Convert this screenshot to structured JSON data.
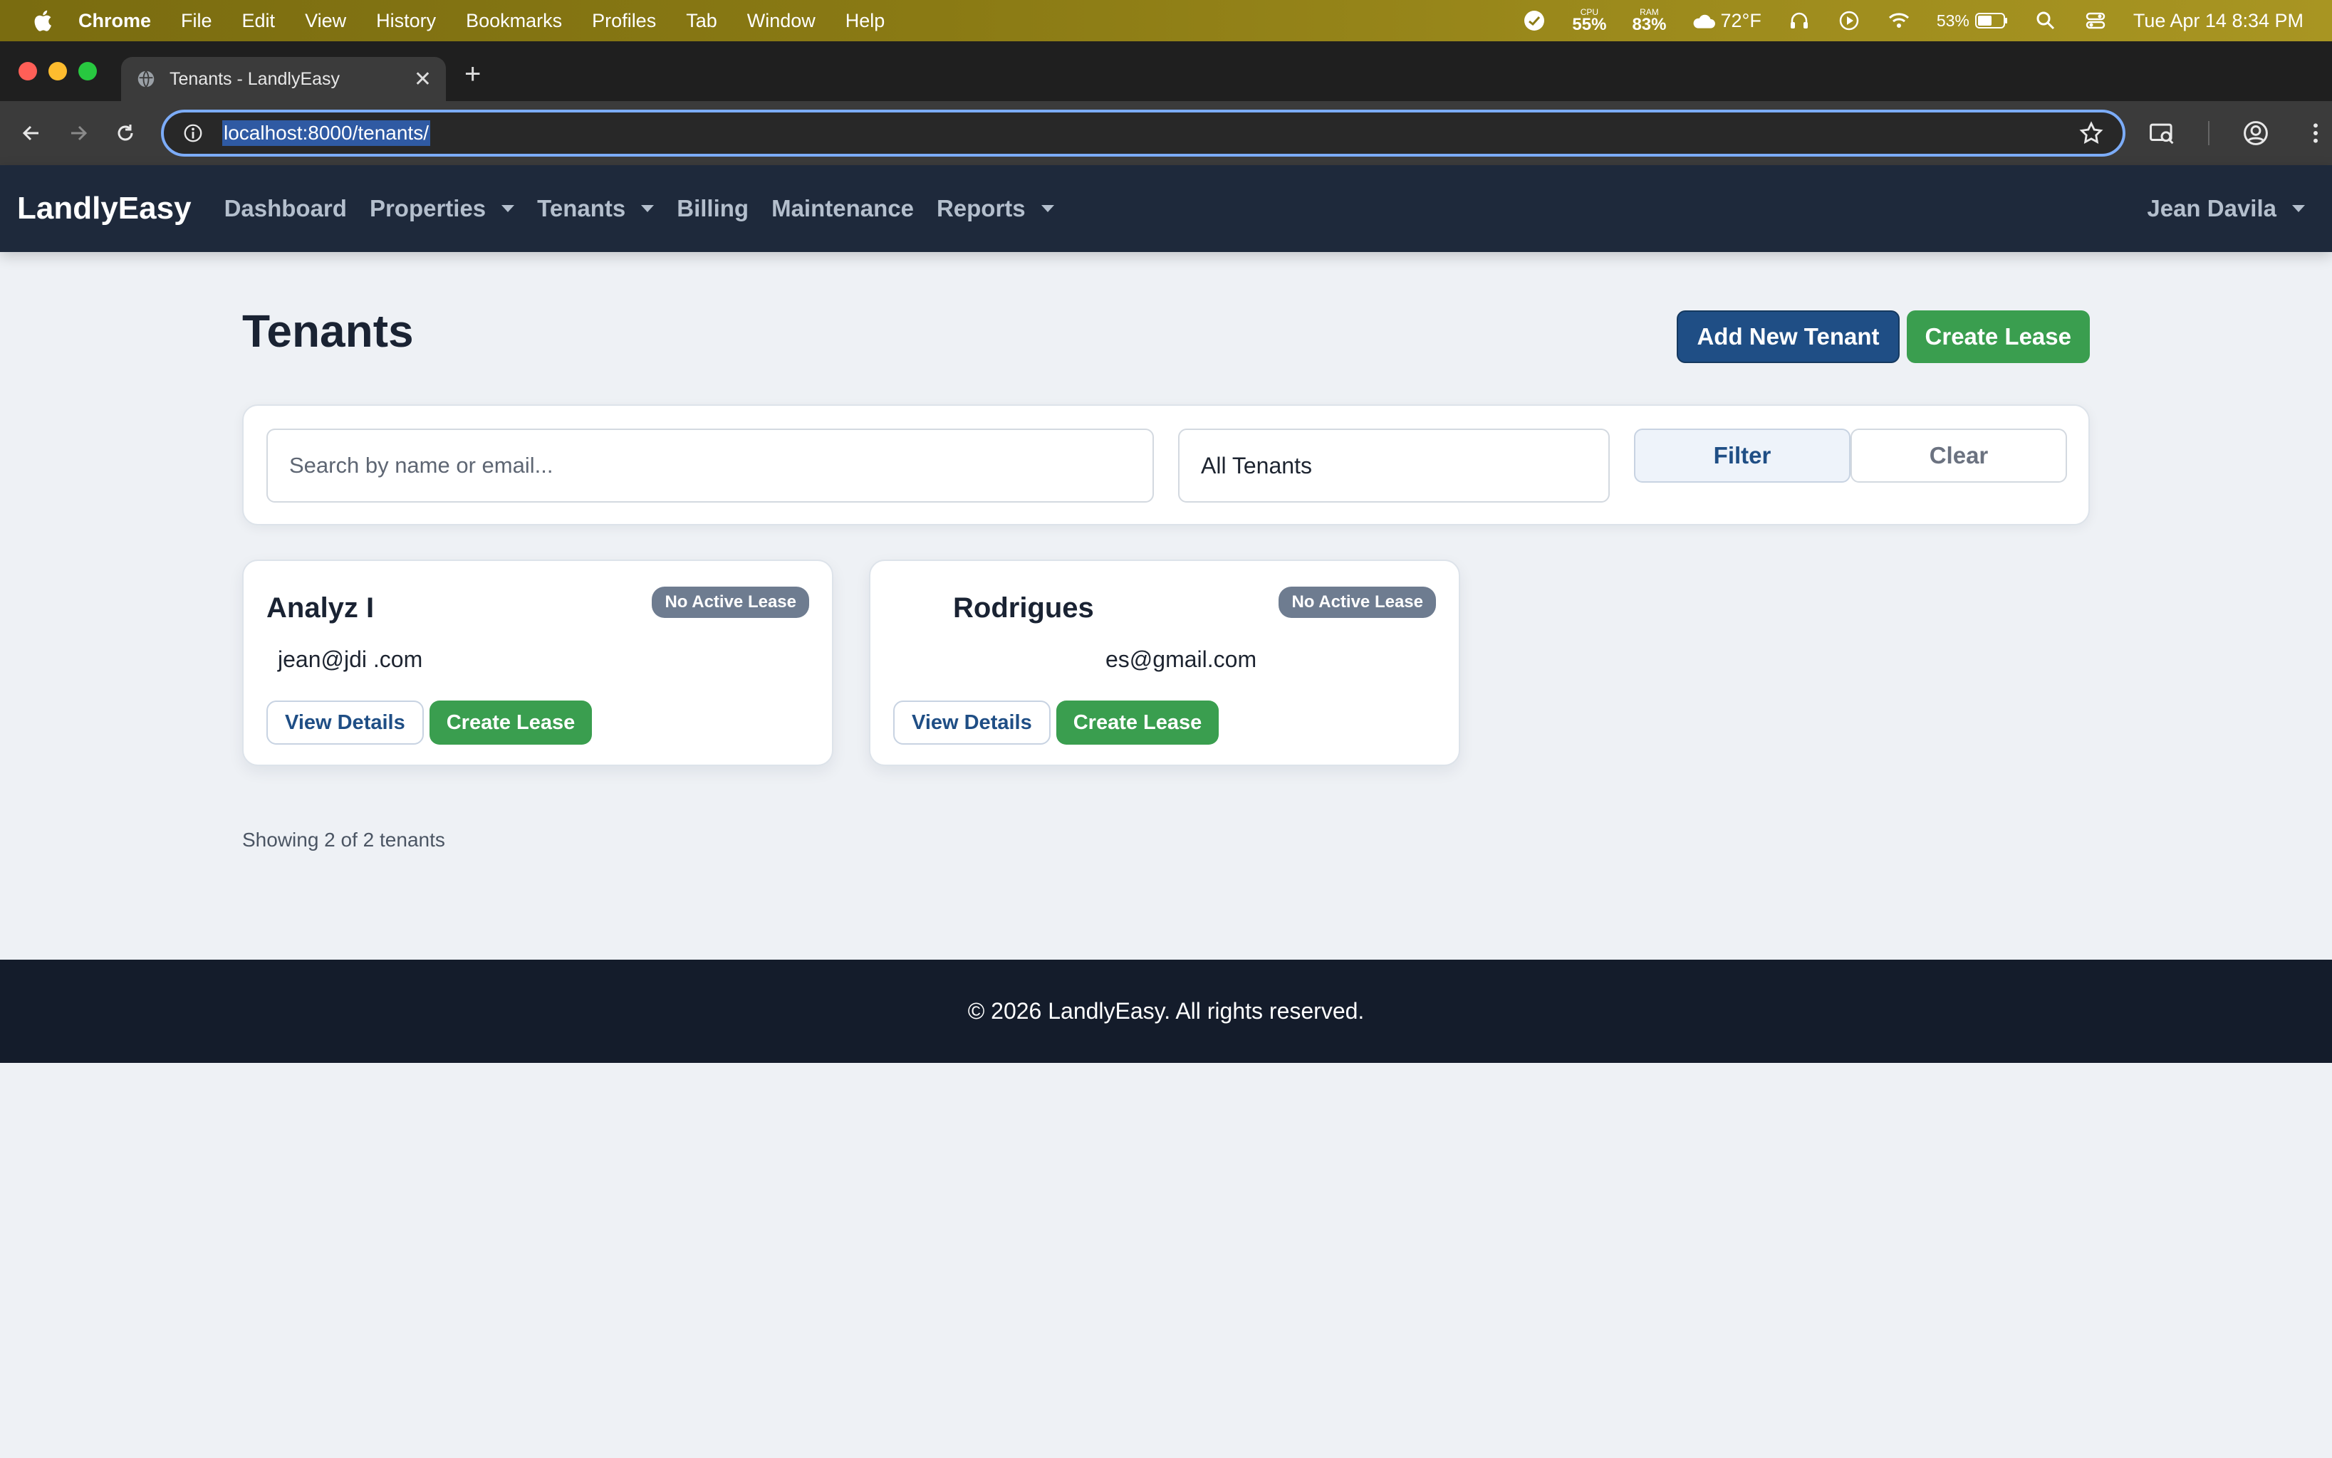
{
  "menubar": {
    "app": "Chrome",
    "items": [
      "File",
      "Edit",
      "View",
      "History",
      "Bookmarks",
      "Profiles",
      "Tab",
      "Window",
      "Help"
    ],
    "cpu_label": "CPU",
    "cpu_value": "55%",
    "ram_label": "RAM",
    "ram_value": "83%",
    "weather": "72°F",
    "battery": "53%",
    "datetime": "Tue Apr 14  8:34 PM"
  },
  "browser": {
    "tab_title": "Tenants - LandlyEasy",
    "url": "localhost:8000/tenants/"
  },
  "site": {
    "brand": "LandlyEasy",
    "nav": [
      "Dashboard",
      "Properties",
      "Tenants",
      "Billing",
      "Maintenance",
      "Reports"
    ],
    "user": "Jean Davila"
  },
  "page": {
    "title": "Tenants",
    "add_button": "Add New Tenant",
    "create_lease_button": "Create Lease"
  },
  "filters": {
    "search_placeholder": "Search by name or email...",
    "select_value": "All Tenants",
    "filter_button": "Filter",
    "clear_button": "Clear"
  },
  "tenants": [
    {
      "name": "Analyz I",
      "badge": "No Active Lease",
      "email": "jean@jdi        .com",
      "view": "View Details",
      "lease": "Create Lease"
    },
    {
      "name": "Rodrigues",
      "badge": "No Active Lease",
      "email": "es@gmail.com",
      "view": "View Details",
      "lease": "Create Lease"
    }
  ],
  "summary": "Showing 2 of 2 tenants",
  "footer": "© 2026 LandlyEasy. All rights reserved."
}
